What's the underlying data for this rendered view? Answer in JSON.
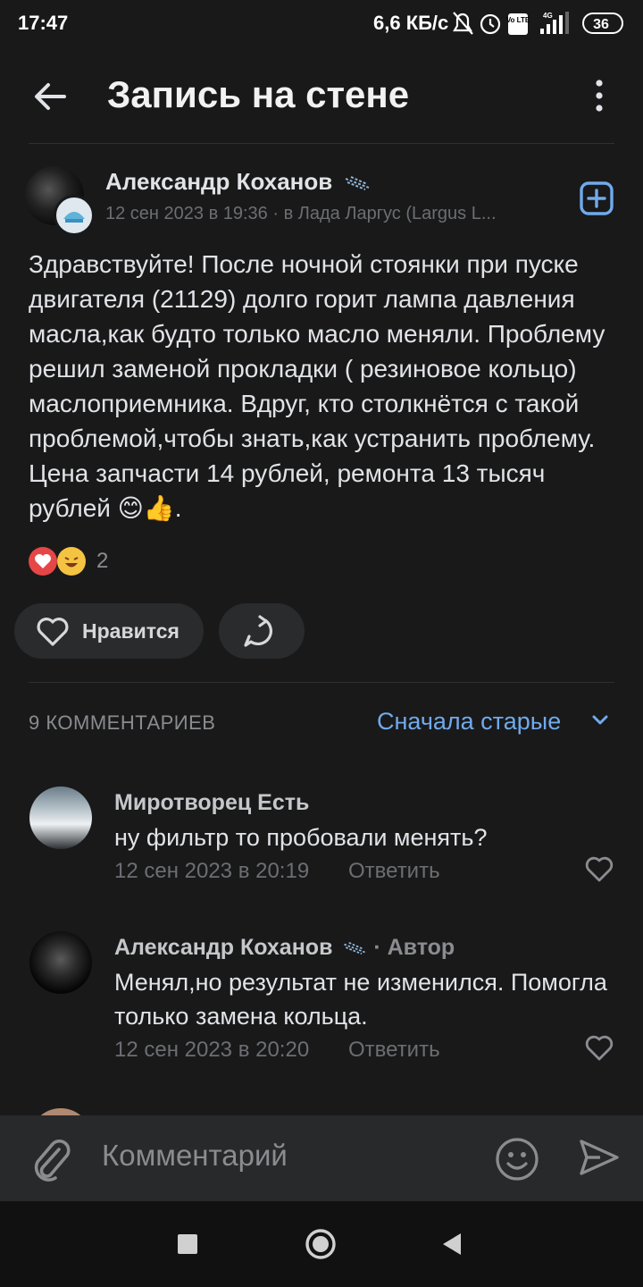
{
  "status_bar": {
    "time": "17:47",
    "speed": "6,6 КБ/с",
    "battery": "36",
    "volte": "Vo LTE",
    "network": "4G"
  },
  "header": {
    "title": "Запись на стене"
  },
  "post": {
    "author": "Александр Коханов",
    "meta": "12 сен 2023 в 19:36 · в Лада Ларгус (Largus L...",
    "text": "Здравствуйте! После ночной стоянки при пуске двигателя (21129) долго горит лампа давления масла,как будто только масло меняли. Проблему решил заменой прокладки ( резиновое кольцо) маслоприемника. Вдруг, кто столкнётся с такой проблемой,чтобы знать,как устранить проблему. Цена запчасти 14 рублей, ремонта 13 тысяч рублей 😊👍.",
    "reactions_count": "2",
    "like_label": "Нравится"
  },
  "comments_header": {
    "count_label": "9 КОММЕНТАРИЕВ",
    "sort_label": "Сначала старые"
  },
  "comments": [
    {
      "name": "Миротворец Есть",
      "author_tag": "",
      "text": "ну фильтр то пробовали менять?",
      "time": "12 сен 2023 в 20:19",
      "reply": "Ответить"
    },
    {
      "name": "Александр Коханов",
      "author_tag": "· Автор",
      "text": "Менял,но результат не изменился. Помогла только замена кольца.",
      "time": "12 сен 2023 в 20:20",
      "reply": "Ответить"
    }
  ],
  "input": {
    "placeholder": "Комментарий"
  },
  "colors": {
    "background": "#19191a",
    "accent": "#71aaeb",
    "reaction_heart": "#e64646"
  }
}
